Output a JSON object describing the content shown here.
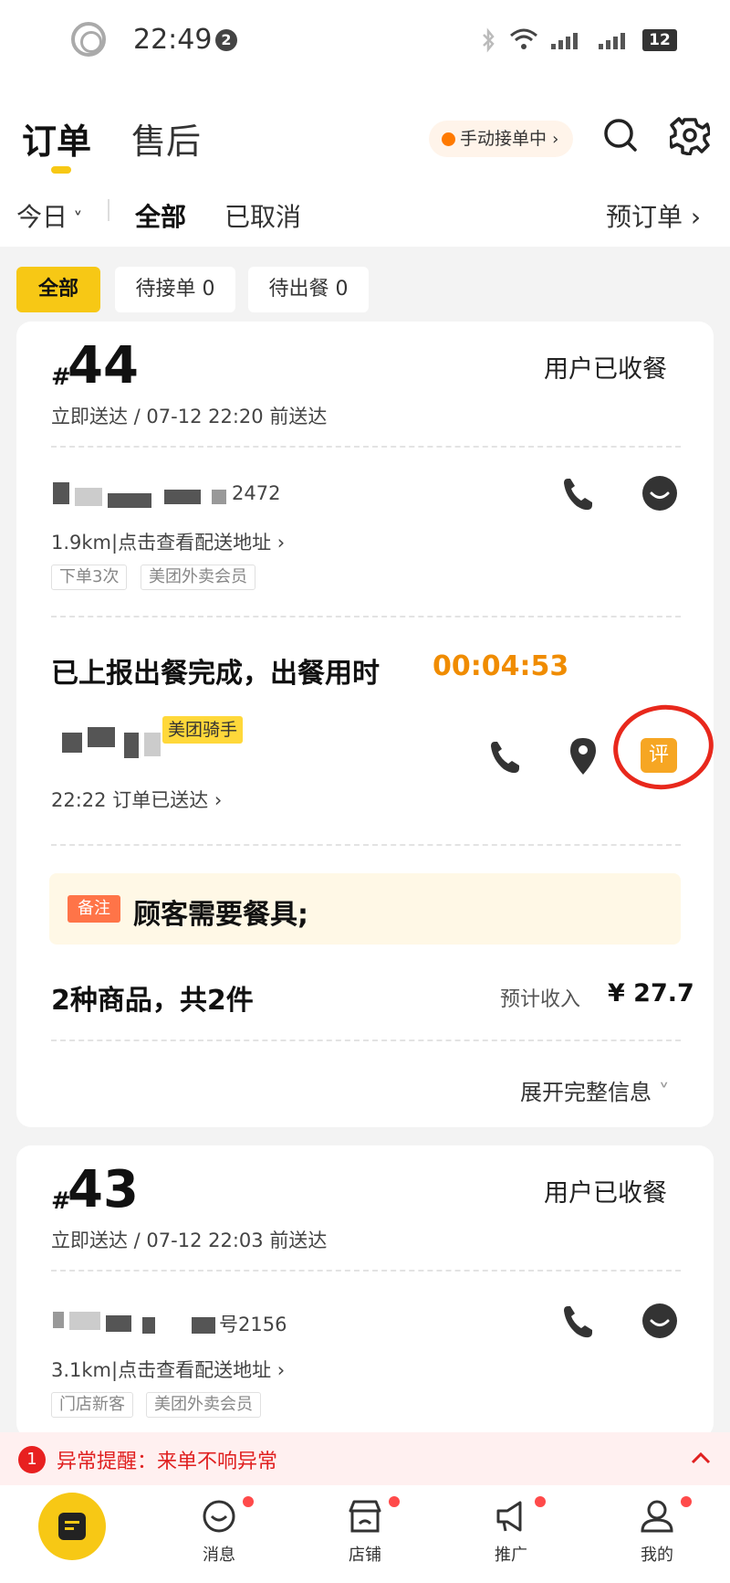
{
  "status_bar": {
    "time": "22:49",
    "notif_count": "2",
    "battery": "12"
  },
  "header": {
    "tab_orders": "订单",
    "tab_aftersale": "售后",
    "manual_accept": "手动接单中",
    "filter_today": "今日",
    "filter_all": "全部",
    "filter_cancelled": "已取消",
    "preorder": "预订单"
  },
  "chips": [
    {
      "label": "全部"
    },
    {
      "label": "待接单 0"
    },
    {
      "label": "待出餐 0"
    }
  ],
  "orders": [
    {
      "hash": "#",
      "number": "44",
      "status": "用户已收餐",
      "delivery": "立即送达 / 07-12 22:20 前送达",
      "phone_tail": "2472",
      "distance": "1.9km|点击查看配送地址",
      "tags": [
        "下单3次",
        "美团外卖会员"
      ],
      "report": "已上报出餐完成，出餐用时",
      "timer": "00:04:53",
      "rider_tag": "美团骑手",
      "rider_status": "22:22 订单已送达",
      "review_label": "评",
      "note_tag": "备注",
      "note": "顾客需要餐具;",
      "items": "2种商品，共2件",
      "income_label": "预计收入",
      "income": "¥ 27.7",
      "expand": "展开完整信息"
    },
    {
      "hash": "#",
      "number": "43",
      "status": "用户已收餐",
      "delivery": "立即送达 / 07-12 22:03 前送达",
      "phone_tail": "号2156",
      "distance": "3.1km|点击查看配送地址",
      "tags": [
        "门店新客",
        "美团外卖会员"
      ]
    }
  ],
  "alert": {
    "badge": "1",
    "text": "异常提醒：来单不响异常"
  },
  "nav": [
    "消息",
    "店铺",
    "推广",
    "我的"
  ],
  "colors": {
    "accent": "#f7c815",
    "timer": "#f08c00",
    "alert": "#e02020"
  }
}
